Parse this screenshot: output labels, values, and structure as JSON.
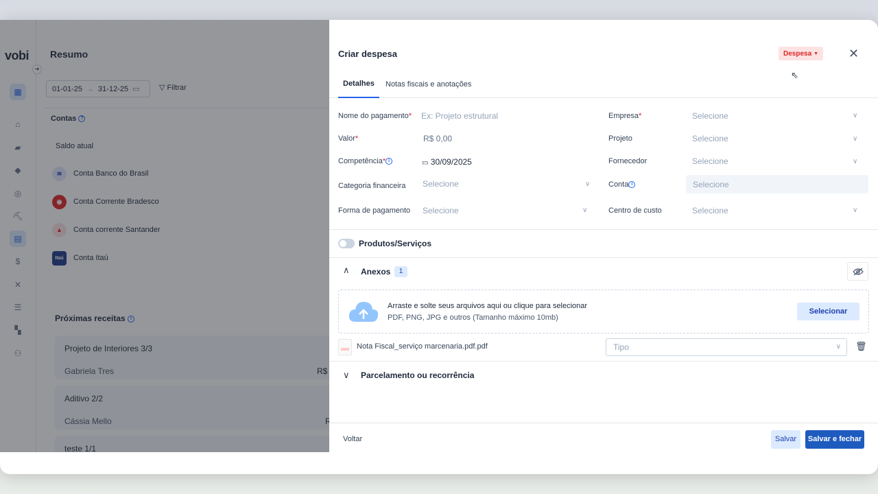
{
  "app": {
    "logo": "vobi",
    "page_title": "Resumo",
    "date_from": "01-01-25",
    "date_to": "31-12-25",
    "filter_label": "Filtrar",
    "contas_title": "Contas",
    "saldo_label": "Saldo atual",
    "accounts": [
      {
        "name": "Conta Banco do Brasil",
        "color": "#e0e7ff",
        "glyph": "≡"
      },
      {
        "name": "Conta Corrente Bradesco",
        "color": "#dc2626",
        "glyph": "◉"
      },
      {
        "name": "Conta corrente Santander",
        "color": "#fee2e2",
        "glyph": "▲"
      },
      {
        "name": "Conta Itaú",
        "color": "#1e3a8a",
        "glyph": "Itaú"
      }
    ],
    "receitas_title": "Próximas receitas",
    "receitas": [
      {
        "title": "Projeto de Interiores 3/3",
        "person": "Gabriela Tres",
        "amount": "R$"
      },
      {
        "title": "Aditivo 2/2",
        "person": "Cássia Mello",
        "amount": "R"
      },
      {
        "title": "teste 1/1"
      }
    ]
  },
  "drawer": {
    "title": "Criar despesa",
    "type_badge": "Despesa",
    "tabs": [
      "Detalhes",
      "Notas fiscais e anotações"
    ],
    "fields": {
      "nome": {
        "label": "Nome do pagamento",
        "placeholder": "Ex: Projeto estrutural"
      },
      "valor": {
        "label": "Valor",
        "value": "R$ 0,00"
      },
      "competencia": {
        "label": "Competência",
        "value": "30/09/2025"
      },
      "categoria": {
        "label": "Categoria financeira",
        "value": "Selecione"
      },
      "forma": {
        "label": "Forma de pagamento",
        "value": "Selecione"
      },
      "empresa": {
        "label": "Empresa",
        "value": "Selecione"
      },
      "projeto": {
        "label": "Projeto",
        "value": "Selecione"
      },
      "fornecedor": {
        "label": "Fornecedor",
        "value": "Selecione"
      },
      "conta": {
        "label": "Conta",
        "value": "Selecione"
      },
      "centro": {
        "label": "Centro de custo",
        "value": "Selecione"
      }
    },
    "produtos_label": "Produtos/Serviços",
    "anexos_label": "Anexos",
    "anexos_count": "1",
    "drop_text": "Arraste e solte seus arquivos aqui ou clique para selecionar",
    "drop_hint": "PDF, PNG, JPG e outros (Tamanho máximo 10mb)",
    "select_button": "Selecionar",
    "file_name": "Nota Fiscal_serviço marcenaria.pdf.pdf",
    "tipo_placeholder": "Tipo",
    "parcelamento_label": "Parcelamento ou recorrência",
    "back_button": "Voltar",
    "save_button": "Salvar",
    "save_close_button": "Salvar e fechar"
  }
}
